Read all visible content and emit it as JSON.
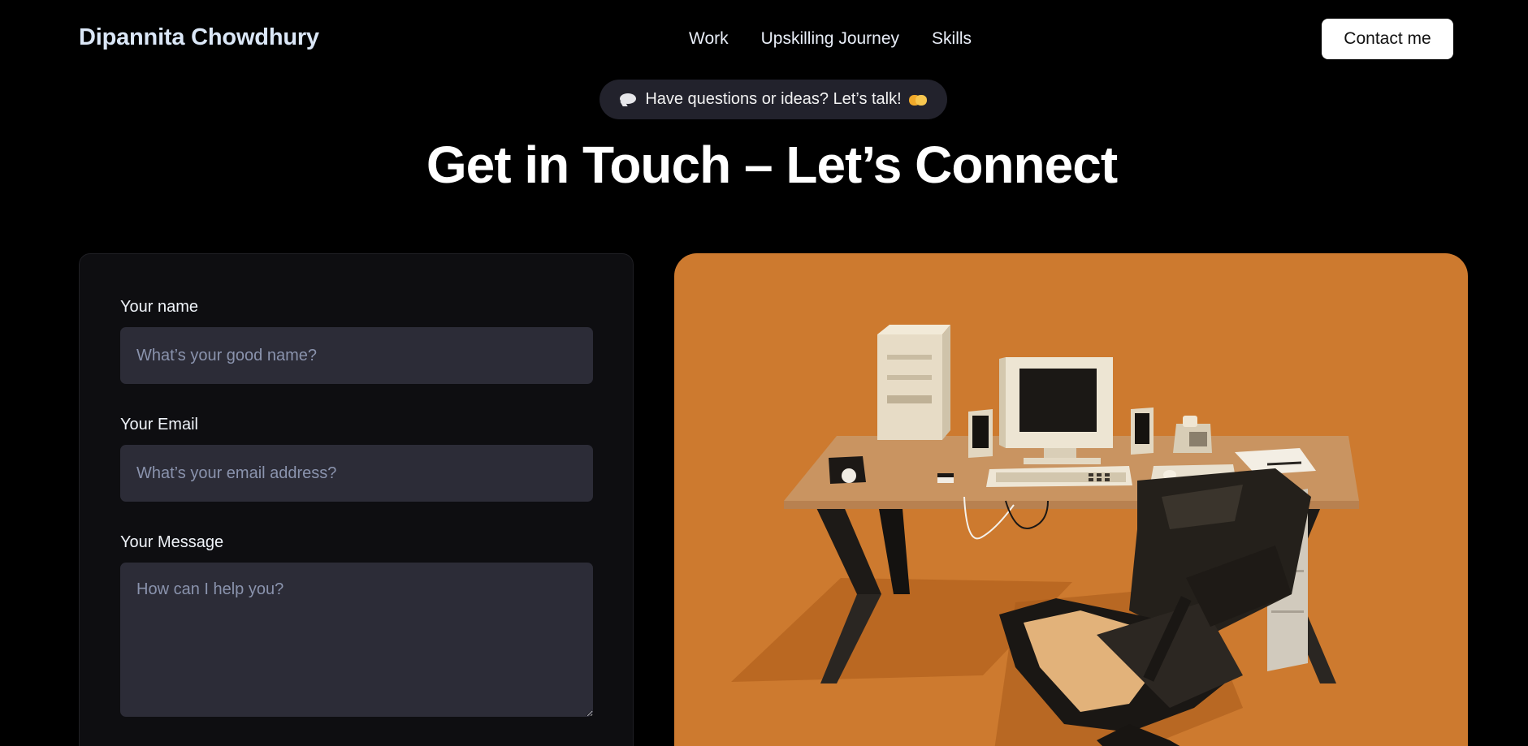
{
  "header": {
    "brand": "Dipannita Chowdhury",
    "nav": [
      {
        "label": "Work"
      },
      {
        "label": "Upskilling Journey"
      },
      {
        "label": "Skills"
      }
    ],
    "contact_label": "Contact me"
  },
  "hero": {
    "pill_text": "Have questions or ideas? Let’s talk!",
    "pill_icons": [
      "speech-bubble-icon",
      "handshake-icon"
    ],
    "heading": "Get in Touch – Let’s Connect"
  },
  "form": {
    "name": {
      "label": "Your name",
      "placeholder": "What’s your good name?",
      "value": ""
    },
    "email": {
      "label": "Your Email",
      "placeholder": "What’s your email address?",
      "value": ""
    },
    "message": {
      "label": "Your Message",
      "placeholder": "How can I help you?",
      "value": ""
    }
  },
  "illustration": {
    "description_icon": "retro-desk-3d-illustration",
    "background_color": "#cd7a2f"
  },
  "colors": {
    "page_background": "#000000",
    "card_background": "#0e0e11",
    "input_background": "#2c2c37",
    "pill_background": "#22222c",
    "accent_orange": "#cd7a2f",
    "brand_text": "#dbe7f7"
  }
}
